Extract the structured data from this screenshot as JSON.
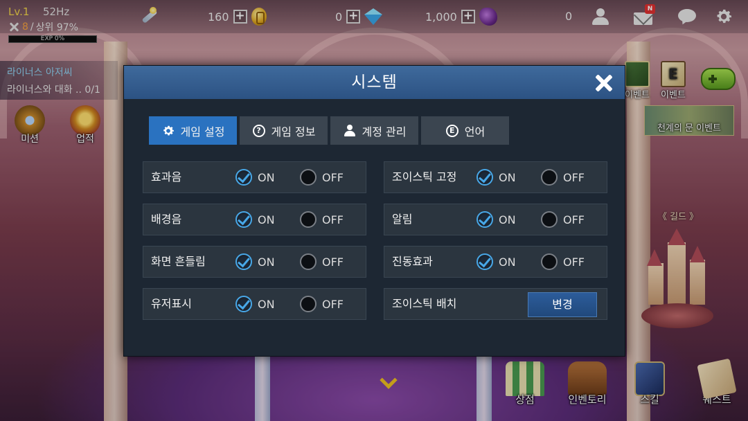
{
  "hud": {
    "level": "Lv.1",
    "refresh_rate": "52Hz",
    "rank_number": "8",
    "rank_slash": "/",
    "rank_percent": "상위 97%",
    "exp_label": "EXP 0%",
    "exp_fraction": 0.0,
    "gold": "160",
    "gems": "0",
    "ore": "1,000",
    "friends_online": "0",
    "mail_badge": "N"
  },
  "quest": {
    "title": "라이너스 아저씨",
    "desc": "라이너스와 대화 .. 0/1"
  },
  "side_buttons": {
    "mission": "미션",
    "achievement": "업적"
  },
  "events": {
    "event1": "이벤트",
    "event2": "이벤트",
    "event2_letter": "E",
    "sky_event": "천계의 문 이벤트"
  },
  "guild": {
    "label": "《 길드 》"
  },
  "bottom_menu": {
    "shop": "상점",
    "inventory": "인벤토리",
    "skill": "스킬",
    "quest": "퀘스트"
  },
  "modal": {
    "title": "시스템",
    "tabs": [
      {
        "label": "게임 설정",
        "icon": "gear-icon",
        "active": true
      },
      {
        "label": "게임 정보",
        "icon": "question-icon",
        "active": false
      },
      {
        "label": "계정 관리",
        "icon": "user-icon",
        "active": false
      },
      {
        "label": "언어",
        "icon": "e-circle-icon",
        "active": false
      }
    ],
    "tab_question_glyph": "?",
    "tab_lang_glyph": "E",
    "on_label": "ON",
    "off_label": "OFF",
    "settings_left": [
      {
        "label": "효과음",
        "value": "ON"
      },
      {
        "label": "배경음",
        "value": "ON"
      },
      {
        "label": "화면 흔들림",
        "value": "ON"
      },
      {
        "label": "유저표시",
        "value": "ON"
      }
    ],
    "settings_right": [
      {
        "label": "조이스틱 고정",
        "value": "ON"
      },
      {
        "label": "알림",
        "value": "ON"
      },
      {
        "label": "진동효과",
        "value": "ON"
      }
    ],
    "joystick_layout": {
      "label": "조이스틱 배치",
      "button": "변경"
    }
  },
  "colors": {
    "header_blue": "#2c5283",
    "active_tab": "#2a72c0",
    "check_blue": "#48a8e8",
    "panel_bg": "#1d2733",
    "row_bg": "#2b353f"
  }
}
